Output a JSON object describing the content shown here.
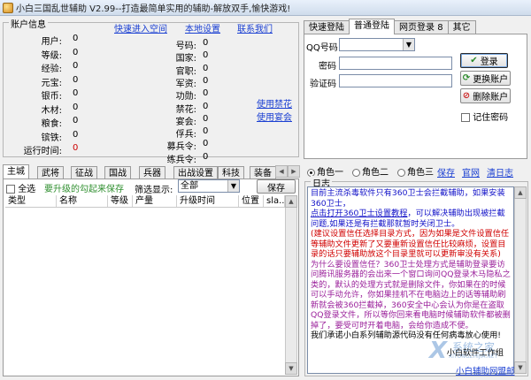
{
  "window": {
    "title": "小白三国乱世辅助 V2.99--打造最简单实用的辅助-解放双手,愉快游戏!"
  },
  "account": {
    "group_title": "账户信息",
    "links": {
      "quick": "快速进入空间",
      "settings": "本地设置",
      "contact": "联系我们"
    },
    "left_fields": [
      {
        "label": "用户:",
        "value": "0"
      },
      {
        "label": "等级:",
        "value": "0"
      },
      {
        "label": "经验:",
        "value": "0"
      },
      {
        "label": "元宝:",
        "value": "0"
      },
      {
        "label": "银币:",
        "value": "0"
      },
      {
        "label": "木材:",
        "value": "0"
      },
      {
        "label": "粮食:",
        "value": "0"
      },
      {
        "label": "镔铁:",
        "value": "0"
      },
      {
        "label": "运行时间:",
        "value": "0"
      }
    ],
    "mid_fields": [
      {
        "label": "号码:",
        "value": "0"
      },
      {
        "label": "国家:",
        "value": "0"
      },
      {
        "label": "官职:",
        "value": "0"
      },
      {
        "label": "军资:",
        "value": "0"
      },
      {
        "label": "功勋:",
        "value": "0"
      },
      {
        "label": "禁花:",
        "value": "0"
      },
      {
        "label": "宴会:",
        "value": "0"
      },
      {
        "label": "俘兵:",
        "value": "0"
      },
      {
        "label": "募兵令:",
        "value": "0"
      },
      {
        "label": "练兵令:",
        "value": "0"
      }
    ],
    "use_links": {
      "jinhua": "使用禁花",
      "banquet": "使用宴会"
    }
  },
  "login": {
    "tabs": [
      "快速登陆",
      "普通登陆",
      "网页登录",
      "其它"
    ],
    "tab_badge": "8",
    "qq_label": "QQ号码",
    "pwd_label": "密码",
    "code_label": "验证码",
    "login_btn": "登录",
    "switch_btn": "更换账户",
    "delete_btn": "删除账户",
    "remember": "记住密码"
  },
  "func_tabs": {
    "items": [
      "主城",
      "武将",
      "征战",
      "国战",
      "兵器",
      "出战设置",
      "科技",
      "装备"
    ],
    "select_all": "全选",
    "hint": "要升级的勾起来保存",
    "filter_label": "筛选显示:",
    "filter_value": "全部",
    "save": "保存",
    "columns": [
      "类型",
      "名称",
      "等级",
      "产量",
      "升级时间",
      "位置",
      "sla..."
    ]
  },
  "roles": {
    "options": [
      "角色一",
      "角色二",
      "角色三"
    ],
    "selected": 0,
    "links": {
      "save": "保存",
      "website": "官网",
      "clear": "清日志"
    }
  },
  "log": {
    "title": "日志",
    "lines": [
      {
        "color": "blue",
        "text": "目前主流杀毒软件只有360卫士会拦截辅助，如果安装360卫士，"
      },
      {
        "color": "blue",
        "text": "点击打开360卫士设置教程",
        "link": true,
        "tail": "，可以解决辅助出现被拦截问题,如果还是有拦截那就暂时关闭卫士。"
      },
      {
        "color": "red2",
        "text": "(建议设置信任选择目录方式，因为如果是文件设置信任等辅助文件更新了又要重新设置信任比较麻烦，设置目录的话只要辅助放这个目录里就可以更新审没有关系)"
      },
      {
        "color": "purple",
        "text": "为什么要设置信任？360卫士处理方式是辅助登录要访问腾讯服务器的会出来一个窗口询问QQ登录木马隐私之类的，默认的处理方式就是删除文件，你如果在的时候可以手动允许，你如果挂机不在电脑边上的话等辅助刷新就会被360拦截掉，360安全中心会认为你是在盗取QQ登录文件，所以等你回来看电脑时候辅助软件都被删掉了，要受可时开着电脑，会给你造成不便。"
      },
      {
        "color": "black",
        "text": "我们承诺小白系列辅助源代码没有任何病毒放心使用!"
      }
    ],
    "signature": "小白软件工作组"
  },
  "status": {
    "tray_link": "小白辅助网盟邮"
  },
  "watermark": {
    "text": "系统之家",
    "sub": "XITONGZHIJIA.NET"
  }
}
